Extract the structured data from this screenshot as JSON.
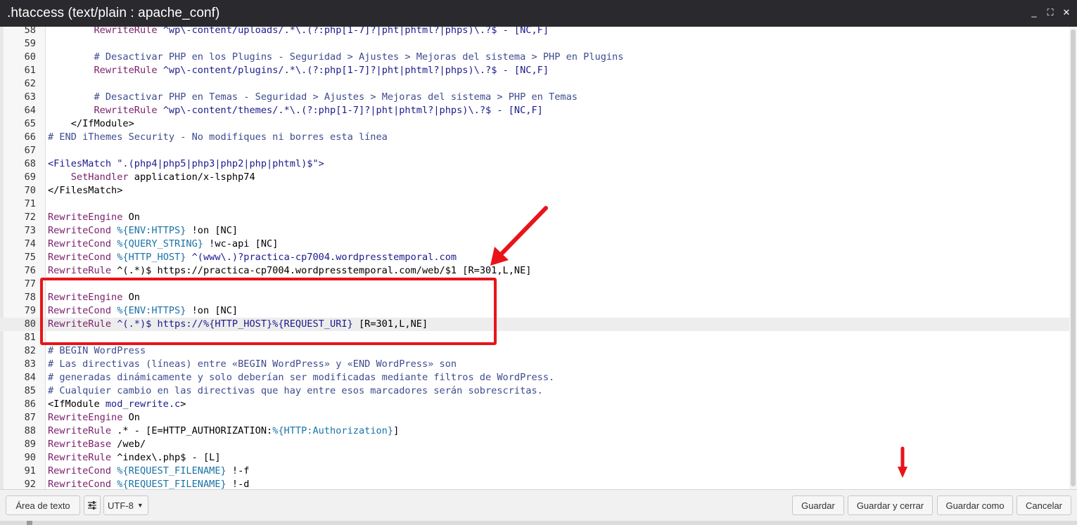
{
  "window": {
    "title": ".htaccess (text/plain : apache_conf)",
    "minimize_glyph": "_",
    "maximize_glyph": "⛶",
    "close_glyph": "✕"
  },
  "editor": {
    "active_line": 80,
    "lines": [
      {
        "n": 58,
        "tokens": [
          {
            "t": "        "
          },
          {
            "t": "RewriteRule",
            "c": "dir"
          },
          {
            "t": " ^wp\\-content/uploads/.*\\.(?:php[1-7]?|pht|phtml?|phps)\\.?$ - [NC,F]",
            "c": "str"
          }
        ]
      },
      {
        "n": 59,
        "tokens": []
      },
      {
        "n": 60,
        "tokens": [
          {
            "t": "        "
          },
          {
            "t": "# Desactivar PHP en los Plugins - Seguridad > Ajustes > Mejoras del sistema > PHP en Plugins",
            "c": "com"
          }
        ]
      },
      {
        "n": 61,
        "tokens": [
          {
            "t": "        "
          },
          {
            "t": "RewriteRule",
            "c": "dir"
          },
          {
            "t": " ^wp\\-content/plugins/.*\\.(?:php[1-7]?|pht|phtml?|phps)\\.?$ - [NC,F]",
            "c": "str"
          }
        ]
      },
      {
        "n": 62,
        "tokens": []
      },
      {
        "n": 63,
        "tokens": [
          {
            "t": "        "
          },
          {
            "t": "# Desactivar PHP en Temas - Seguridad > Ajustes > Mejoras del sistema > PHP en Temas",
            "c": "com"
          }
        ]
      },
      {
        "n": 64,
        "tokens": [
          {
            "t": "        "
          },
          {
            "t": "RewriteRule",
            "c": "dir"
          },
          {
            "t": " ^wp\\-content/themes/.*\\.(?:php[1-7]?|pht|phtml?|phps)\\.?$ - [NC,F]",
            "c": "str"
          }
        ]
      },
      {
        "n": 65,
        "tokens": [
          {
            "t": "    </IfModule>",
            "c": "def"
          }
        ]
      },
      {
        "n": 66,
        "tokens": [
          {
            "t": "# END iThemes Security - No modifiques ni borres esta línea",
            "c": "com"
          }
        ]
      },
      {
        "n": 67,
        "tokens": []
      },
      {
        "n": 68,
        "tokens": [
          {
            "t": "<FilesMatch \".(php4|php5|php3|php2|php|phtml)$\">",
            "c": "str"
          }
        ]
      },
      {
        "n": 69,
        "tokens": [
          {
            "t": "    "
          },
          {
            "t": "SetHandler",
            "c": "dir"
          },
          {
            "t": " application/x-lsphp74",
            "c": "def"
          }
        ]
      },
      {
        "n": 70,
        "tokens": [
          {
            "t": "</FilesMatch>",
            "c": "def"
          }
        ]
      },
      {
        "n": 71,
        "tokens": []
      },
      {
        "n": 72,
        "tokens": [
          {
            "t": "RewriteEngine",
            "c": "dir"
          },
          {
            "t": " On",
            "c": "def"
          }
        ]
      },
      {
        "n": 73,
        "tokens": [
          {
            "t": "RewriteCond",
            "c": "dir"
          },
          {
            "t": " %{ENV:HTTPS}",
            "c": "var"
          },
          {
            "t": " !on [NC]",
            "c": "def"
          }
        ]
      },
      {
        "n": 74,
        "tokens": [
          {
            "t": "RewriteCond",
            "c": "dir"
          },
          {
            "t": " %{QUERY_STRING}",
            "c": "var"
          },
          {
            "t": " !wc-api [NC]",
            "c": "def"
          }
        ]
      },
      {
        "n": 75,
        "tokens": [
          {
            "t": "RewriteCond",
            "c": "dir"
          },
          {
            "t": " %{HTTP_HOST}",
            "c": "var"
          },
          {
            "t": " ^(www\\.)?practica-cp7004.wordpresstemporal.com",
            "c": "str"
          }
        ]
      },
      {
        "n": 76,
        "tokens": [
          {
            "t": "RewriteRule",
            "c": "dir"
          },
          {
            "t": " ^(.*)$ https://practica-cp7004.wordpresstemporal.com/web/$1 [R=301,L,NE]",
            "c": "def"
          }
        ]
      },
      {
        "n": 77,
        "tokens": []
      },
      {
        "n": 78,
        "tokens": [
          {
            "t": "RewriteEngine",
            "c": "dir"
          },
          {
            "t": " On",
            "c": "def"
          }
        ]
      },
      {
        "n": 79,
        "tokens": [
          {
            "t": "RewriteCond",
            "c": "dir"
          },
          {
            "t": " %{ENV:HTTPS}",
            "c": "var"
          },
          {
            "t": " !on [NC]",
            "c": "def"
          }
        ]
      },
      {
        "n": 80,
        "tokens": [
          {
            "t": "RewriteRule",
            "c": "dir"
          },
          {
            "t": " ^(.*)$ https://%{HTTP_HOST}%{REQUEST_URI}",
            "c": "str"
          },
          {
            "t": " [R=301,L,NE]",
            "c": "def"
          }
        ]
      },
      {
        "n": 81,
        "tokens": []
      },
      {
        "n": 82,
        "tokens": [
          {
            "t": "# BEGIN WordPress",
            "c": "com"
          }
        ]
      },
      {
        "n": 83,
        "tokens": [
          {
            "t": "# Las directivas (líneas) entre «BEGIN WordPress» y «END WordPress» son",
            "c": "com"
          }
        ]
      },
      {
        "n": 84,
        "tokens": [
          {
            "t": "# generadas dinámicamente y solo deberían ser modificadas mediante filtros de WordPress.",
            "c": "com"
          }
        ]
      },
      {
        "n": 85,
        "tokens": [
          {
            "t": "# Cualquier cambio en las directivas que hay entre esos marcadores serán sobrescritas.",
            "c": "com"
          }
        ]
      },
      {
        "n": 86,
        "tokens": [
          {
            "t": "<IfModule ",
            "c": "def"
          },
          {
            "t": "mod_rewrite.c",
            "c": "str"
          },
          {
            "t": ">",
            "c": "def"
          }
        ]
      },
      {
        "n": 87,
        "tokens": [
          {
            "t": "RewriteEngine",
            "c": "dir"
          },
          {
            "t": " On",
            "c": "def"
          }
        ]
      },
      {
        "n": 88,
        "tokens": [
          {
            "t": "RewriteRule",
            "c": "dir"
          },
          {
            "t": " .* - [E=HTTP_AUTHORIZATION:",
            "c": "def"
          },
          {
            "t": "%{HTTP:Authorization}",
            "c": "var"
          },
          {
            "t": "]",
            "c": "def"
          }
        ]
      },
      {
        "n": 89,
        "tokens": [
          {
            "t": "RewriteBase",
            "c": "dir"
          },
          {
            "t": " /web/",
            "c": "def"
          }
        ]
      },
      {
        "n": 90,
        "tokens": [
          {
            "t": "RewriteRule",
            "c": "dir"
          },
          {
            "t": " ^index\\.php$ - [L]",
            "c": "def"
          }
        ]
      },
      {
        "n": 91,
        "tokens": [
          {
            "t": "RewriteCond",
            "c": "dir"
          },
          {
            "t": " %{REQUEST_FILENAME}",
            "c": "var"
          },
          {
            "t": " !-f",
            "c": "def"
          }
        ]
      },
      {
        "n": 92,
        "tokens": [
          {
            "t": "RewriteCond",
            "c": "dir"
          },
          {
            "t": " %{REQUEST_FILENAME}",
            "c": "var"
          },
          {
            "t": " !-d",
            "c": "def"
          }
        ]
      }
    ]
  },
  "footer": {
    "textarea_button": "Área de texto",
    "settings_icon": "sliders-icon",
    "encoding": "UTF-8",
    "save": "Guardar",
    "save_close": "Guardar y cerrar",
    "save_as": "Guardar como",
    "cancel": "Cancelar"
  },
  "annotations": {
    "color": "#e8141a"
  }
}
